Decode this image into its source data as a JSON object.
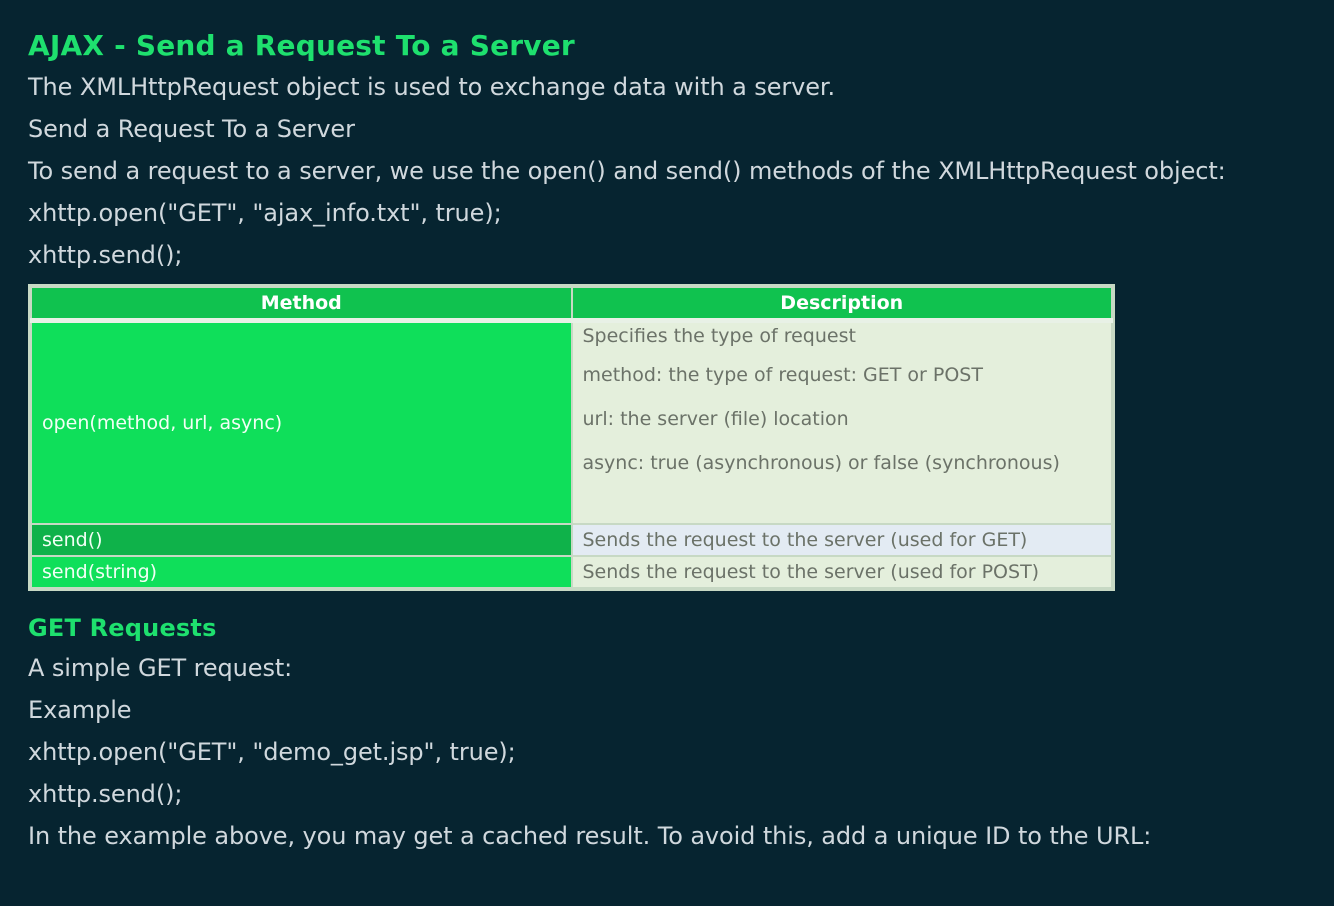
{
  "title": "AJAX - Send a Request To a Server",
  "intro": [
    "The XMLHttpRequest object is used to exchange data with a server.",
    "Send a Request To a Server",
    "To send a request to a server, we use the open() and send() methods of the XMLHttpRequest object:",
    "xhttp.open(\"GET\", \"ajax_info.txt\", true);",
    "xhttp.send();"
  ],
  "table": {
    "headers": [
      "Method",
      "Description"
    ],
    "rows": [
      {
        "method": "open(method, url, async)",
        "description": [
          "Specifies the type of request",
          "method: the type of request: GET or POST",
          "url: the server (file) location",
          "async: true (asynchronous) or false (synchronous)"
        ]
      },
      {
        "method": "send()",
        "description": [
          "Sends the request to the server (used for GET)"
        ]
      },
      {
        "method": "send(string)",
        "description": [
          "Sends the request to the server (used for POST)"
        ]
      }
    ]
  },
  "get_section": {
    "title": "GET Requests",
    "lines": [
      "A simple GET request:",
      "Example",
      "xhttp.open(\"GET\", \"demo_get.jsp\", true);",
      "xhttp.send();",
      "In the example above, you may get a cached result. To avoid this, add a unique ID to the URL:"
    ]
  },
  "colors": {
    "background": "#062430",
    "heading": "#1ee06e",
    "table_header": "#10c24f",
    "method_cell": "#0fdf5a",
    "desc_cell": "#e4efdc"
  }
}
